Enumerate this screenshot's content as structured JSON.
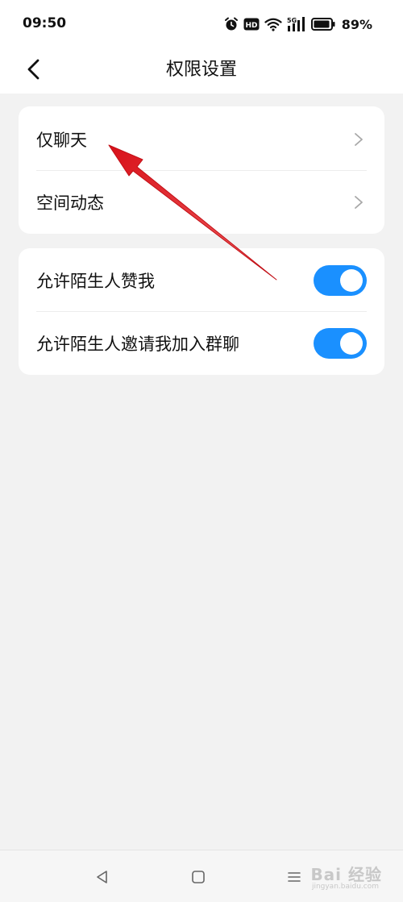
{
  "status_bar": {
    "time": "09:50",
    "network": "5G",
    "hd": "HD",
    "battery": "89%",
    "icons": [
      "alarm-icon",
      "hd-icon",
      "wifi-icon",
      "signal-5g-icon",
      "battery-icon"
    ]
  },
  "header": {
    "title": "权限设置",
    "back_icon": "chevron-left-icon"
  },
  "group1": {
    "items": [
      {
        "label": "仅聊天",
        "icon": "chevron-right-icon"
      },
      {
        "label": "空间动态",
        "icon": "chevron-right-icon"
      }
    ]
  },
  "group2": {
    "items": [
      {
        "label": "允许陌生人赞我",
        "enabled": true
      },
      {
        "label": "允许陌生人邀请我加入群聊",
        "enabled": true
      }
    ]
  },
  "nav_bar": {
    "icons": [
      "back-triangle-icon",
      "home-square-icon",
      "menu-icon"
    ]
  },
  "watermark": {
    "text": "Bai 经验",
    "sub": "jingyan.baidu.com"
  },
  "colors": {
    "toggle_on": "#1a90ff",
    "annotation_arrow": "#e4141b",
    "background": "#f2f2f2"
  }
}
